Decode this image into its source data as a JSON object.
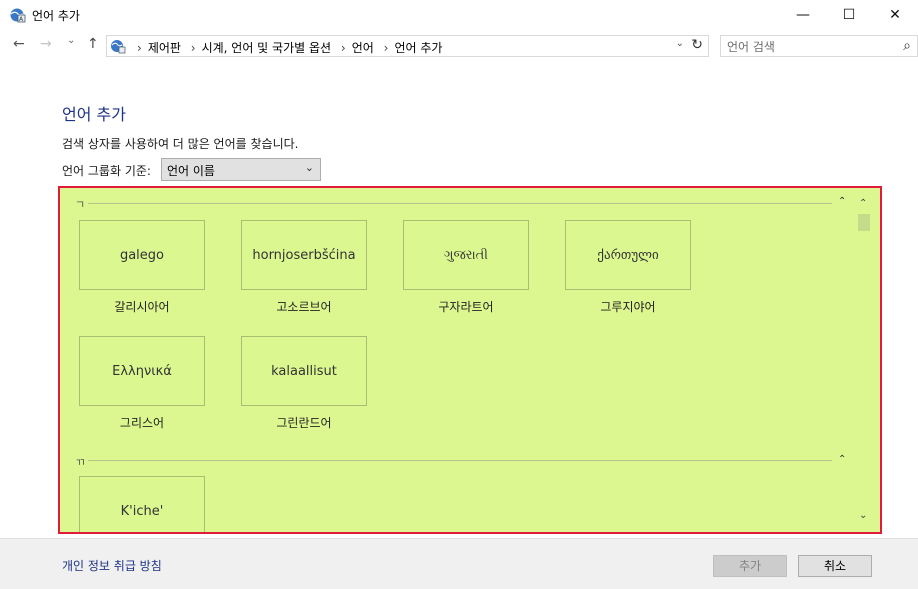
{
  "window": {
    "title": "언어 추가",
    "minimize_glyph": "—",
    "maximize_glyph": "☐",
    "close_glyph": "✕"
  },
  "nav": {
    "back_glyph": "←",
    "forward_glyph": "→",
    "recent_glyph": "⌄",
    "up_glyph": "↑"
  },
  "address": {
    "breadcrumbs": [
      "제어판",
      "시계, 언어 및 국가별 옵션",
      "언어",
      "언어 추가"
    ],
    "separator": "›",
    "dropdown_glyph": "⌄",
    "refresh_glyph": "↻"
  },
  "search": {
    "placeholder": "언어 검색",
    "icon": "search-icon",
    "glyph": "⌕"
  },
  "content": {
    "heading": "언어 추가",
    "description": "검색 상자를 사용하여 더 많은 언어를 찾습니다.",
    "group_by_label": "언어 그룹화 기준:",
    "group_by_value": "언어 이름",
    "group_by_arrow": "⌄"
  },
  "sections": [
    {
      "letter": "ㄱ",
      "languages": [
        {
          "native": "galego",
          "label": "갈리시아어"
        },
        {
          "native": "hornjoserbšćina",
          "label": "고소르브어"
        },
        {
          "native": "ગુજરાતી",
          "label": "구자라트어"
        },
        {
          "native": "ქართული",
          "label": "그루지야어"
        },
        {
          "native": "Ελληνικά",
          "label": "그리스어"
        },
        {
          "native": "kalaallisut",
          "label": "그린란드어"
        }
      ]
    },
    {
      "letter": "ㄲ",
      "languages": [
        {
          "native": "K'iche'",
          "label": ""
        }
      ]
    }
  ],
  "scroll": {
    "collapse_glyph": "⌃",
    "up_glyph": "⌃",
    "down_glyph": "⌄"
  },
  "footer": {
    "privacy_link": "개인 정보 취급 방침",
    "add_button": "추가",
    "cancel_button": "취소"
  },
  "colors": {
    "highlight_border": "#e01b3c",
    "panel_background": "#dcf78f",
    "link": "#1e3287"
  }
}
